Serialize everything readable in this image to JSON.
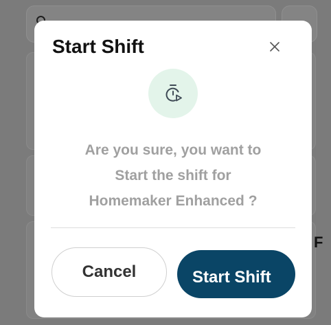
{
  "modal": {
    "title": "Start Shift",
    "close_icon": "close-icon",
    "hero_icon": "stopwatch-play-icon",
    "message_lines": [
      "Are you sure, you want to",
      "Start the shift for",
      "Homemaker Enhanced ?"
    ],
    "cancel_label": "Cancel",
    "confirm_label": "Start Shift"
  },
  "background": {
    "search_icon": "search-icon",
    "filter_icon": "filter-icon",
    "partial_letter": "F"
  },
  "colors": {
    "overlay": "#7b7b7b",
    "primary": "#0a4566",
    "icon_bg": "#e3f4ea",
    "icon_color": "#3e4a55",
    "message_text": "#a0a0a0"
  }
}
